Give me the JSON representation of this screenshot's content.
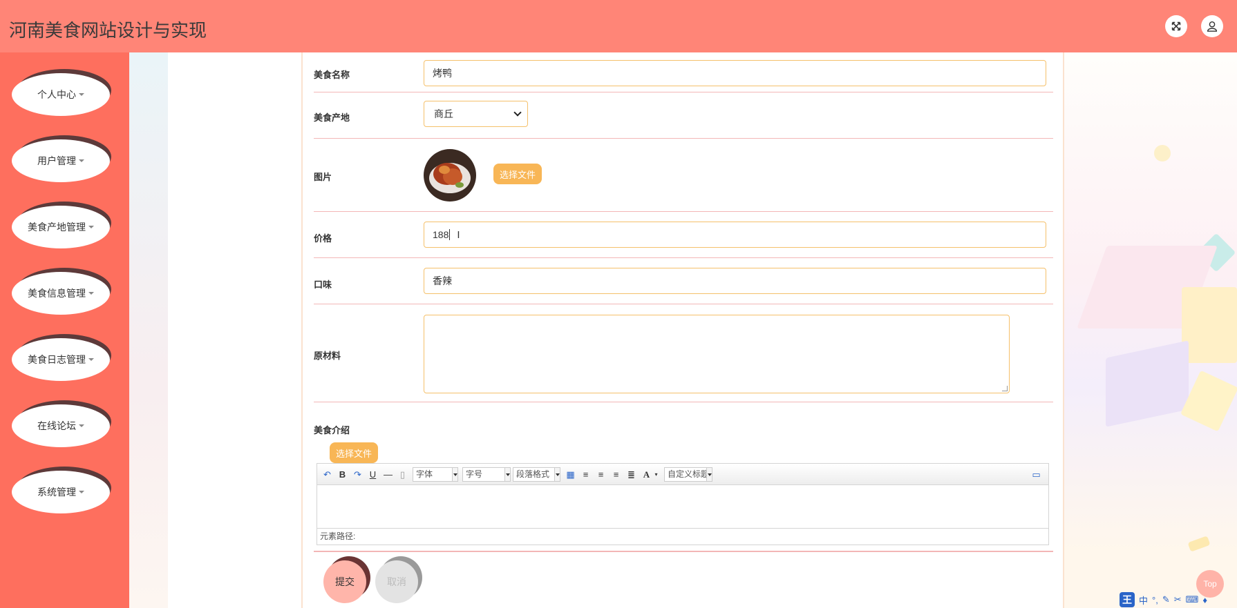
{
  "header": {
    "title": "河南美食网站设计与实现"
  },
  "sidebar": {
    "items": [
      {
        "label": "个人中心"
      },
      {
        "label": "用户管理"
      },
      {
        "label": "美食产地管理"
      },
      {
        "label": "美食信息管理"
      },
      {
        "label": "美食日志管理"
      },
      {
        "label": "在线论坛"
      },
      {
        "label": "系统管理"
      }
    ]
  },
  "form": {
    "name": {
      "label": "美食名称",
      "value": "烤鸭"
    },
    "origin": {
      "label": "美食产地",
      "value": "商丘"
    },
    "image": {
      "label": "图片",
      "button": "选择文件"
    },
    "price": {
      "label": "价格",
      "value": "188"
    },
    "taste": {
      "label": "口味",
      "value": "香辣"
    },
    "ingredients": {
      "label": "原材料",
      "value": ""
    },
    "intro": {
      "label": "美食介绍",
      "button": "选择文件"
    },
    "submit": "提交",
    "cancel": "取消"
  },
  "editor": {
    "font_family": "字体",
    "font_size": "字号",
    "paragraph": "段落格式",
    "custom_title": "自定义标题",
    "element_path": "元素路径:"
  },
  "misc": {
    "top": "Top",
    "ime_logo": "王",
    "ime_mode": "中"
  }
}
